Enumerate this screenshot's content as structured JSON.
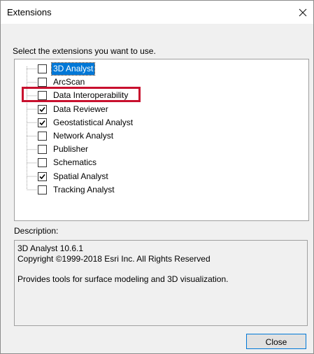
{
  "dialog": {
    "title": "Extensions",
    "close_icon": "close-x-icon",
    "prompt": "Select the extensions you want to use."
  },
  "extensions": [
    {
      "label": "3D Analyst",
      "checked": false,
      "selected": true
    },
    {
      "label": "ArcScan",
      "checked": false,
      "selected": false
    },
    {
      "label": "Data Interoperability",
      "checked": false,
      "selected": false,
      "highlighted": true
    },
    {
      "label": "Data Reviewer",
      "checked": true,
      "selected": false
    },
    {
      "label": "Geostatistical Analyst",
      "checked": true,
      "selected": false
    },
    {
      "label": "Network Analyst",
      "checked": false,
      "selected": false
    },
    {
      "label": "Publisher",
      "checked": false,
      "selected": false
    },
    {
      "label": "Schematics",
      "checked": false,
      "selected": false
    },
    {
      "label": "Spatial Analyst",
      "checked": true,
      "selected": false
    },
    {
      "label": "Tracking Analyst",
      "checked": false,
      "selected": false
    }
  ],
  "description": {
    "label": "Description:",
    "line1": "3D Analyst 10.6.1",
    "line2": "Copyright ©1999-2018 Esri Inc. All Rights Reserved",
    "line3": "Provides tools for surface modeling and 3D visualization."
  },
  "buttons": {
    "close_label": "Close"
  },
  "colors": {
    "highlight_border": "#c8102e",
    "selection": "#0078d7"
  }
}
